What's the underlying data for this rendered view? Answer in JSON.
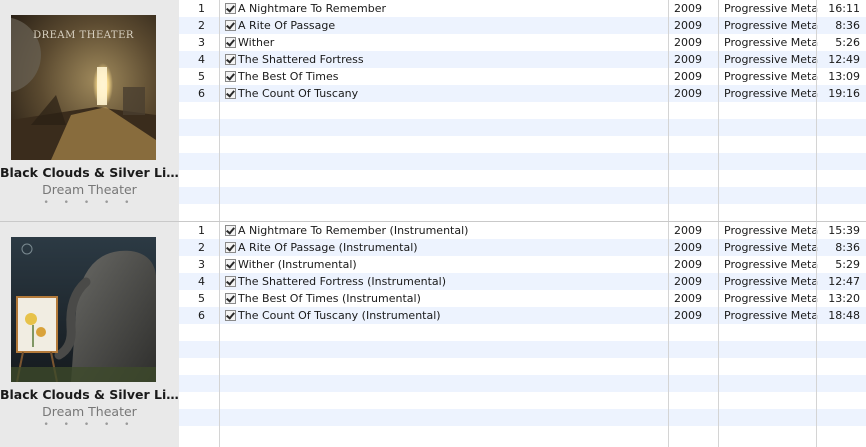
{
  "albums": [
    {
      "title": "Black Clouds & Silver Lini...",
      "artist": "Dream Theater",
      "art_logo": "DREAM THEATER",
      "rating_dots": "• • • • •",
      "tracks": [
        {
          "num": "1",
          "name": "A Nightmare To Remember",
          "year": "2009",
          "genre": "Progressive Metal",
          "time": "16:11",
          "checked": true
        },
        {
          "num": "2",
          "name": "A Rite Of Passage",
          "year": "2009",
          "genre": "Progressive Metal",
          "time": "8:36",
          "checked": true
        },
        {
          "num": "3",
          "name": "Wither",
          "year": "2009",
          "genre": "Progressive Metal",
          "time": "5:26",
          "checked": true
        },
        {
          "num": "4",
          "name": "The Shattered Fortress",
          "year": "2009",
          "genre": "Progressive Metal",
          "time": "12:49",
          "checked": true
        },
        {
          "num": "5",
          "name": "The Best Of Times",
          "year": "2009",
          "genre": "Progressive Metal",
          "time": "13:09",
          "checked": true
        },
        {
          "num": "6",
          "name": "The Count Of Tuscany",
          "year": "2009",
          "genre": "Progressive Metal",
          "time": "19:16",
          "checked": true
        }
      ]
    },
    {
      "title": "Black Clouds & Silver Lini...",
      "artist": "Dream Theater",
      "rating_dots": "• • • • •",
      "tracks": [
        {
          "num": "1",
          "name": "A Nightmare To Remember (Instrumental)",
          "year": "2009",
          "genre": "Progressive Metal",
          "time": "15:39",
          "checked": true
        },
        {
          "num": "2",
          "name": "A Rite Of Passage (Instrumental)",
          "year": "2009",
          "genre": "Progressive Metal",
          "time": "8:36",
          "checked": true
        },
        {
          "num": "3",
          "name": "Wither (Instrumental)",
          "year": "2009",
          "genre": "Progressive Metal",
          "time": "5:29",
          "checked": true
        },
        {
          "num": "4",
          "name": "The Shattered Fortress (Instrumental)",
          "year": "2009",
          "genre": "Progressive Metal",
          "time": "12:47",
          "checked": true
        },
        {
          "num": "5",
          "name": "The Best Of Times (Instrumental)",
          "year": "2009",
          "genre": "Progressive Metal",
          "time": "13:20",
          "checked": true
        },
        {
          "num": "6",
          "name": "The Count Of Tuscany (Instrumental)",
          "year": "2009",
          "genre": "Progressive Metal",
          "time": "18:48",
          "checked": true
        }
      ]
    }
  ],
  "colors": {
    "row_alt": "#edf3fe",
    "panel": "#e9e9e9",
    "grid": "#d4d4d4"
  }
}
